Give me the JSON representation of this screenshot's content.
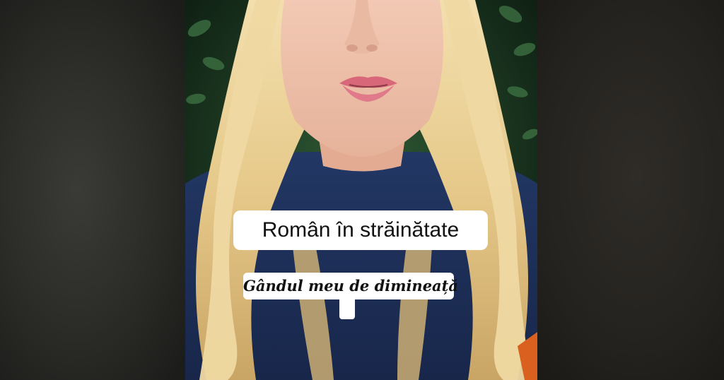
{
  "overlay": {
    "caption_main": "Român în străinătate",
    "caption_sub": "Gândul meu de dimineață"
  },
  "colors": {
    "caption_background": "#ffffff",
    "caption_text": "#111111",
    "backdrop": "#222320",
    "hair": "#e8cf94",
    "sweater": "#1e2f55",
    "foliage": "#1f3a24"
  },
  "scene": {
    "subject": "portrait-photo",
    "icons": []
  }
}
